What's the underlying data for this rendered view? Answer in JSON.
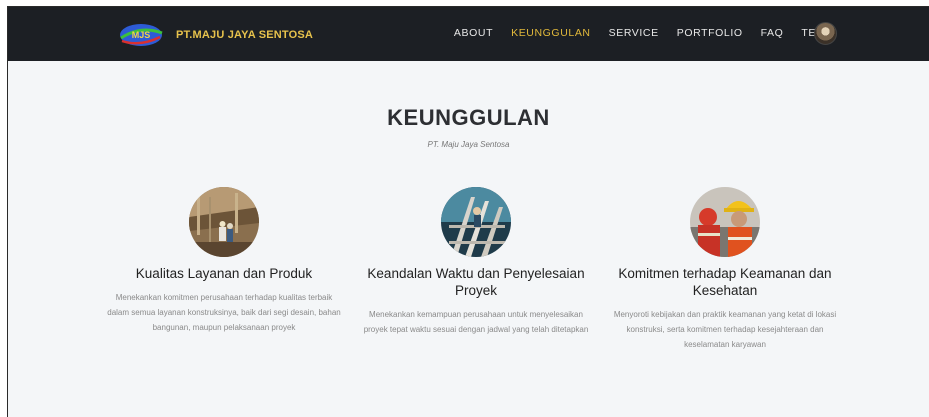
{
  "brand": {
    "name": "PT.MAJU JAYA SENTOSA",
    "logo_text": "MJS"
  },
  "nav": {
    "items": [
      {
        "label": "ABOUT",
        "active": false
      },
      {
        "label": "KEUNGGULAN",
        "active": true
      },
      {
        "label": "SERVICE",
        "active": false
      },
      {
        "label": "PORTFOLIO",
        "active": false
      },
      {
        "label": "FAQ",
        "active": false
      },
      {
        "label": "TEAM",
        "active": false
      }
    ]
  },
  "section": {
    "title": "KEUNGGULAN",
    "subtitle": "PT. Maju Jaya Sentosa"
  },
  "cards": [
    {
      "title": "Kualitas Layanan dan Produk",
      "description": "Menekankan komitmen perusahaan terhadap kualitas terbaik dalam semua layanan konstruksinya, baik dari segi desain, bahan bangunan, maupun pelaksanaan proyek"
    },
    {
      "title": "Keandalan Waktu dan Penyelesaian Proyek",
      "description": "Menekankan kemampuan perusahaan untuk menyelesaikan proyek tepat waktu sesuai dengan jadwal yang telah ditetapkan"
    },
    {
      "title": "Komitmen terhadap Keamanan dan Kesehatan",
      "description": "Menyoroti kebijakan dan praktik keamanan yang ketat di lokasi konstruksi, serta komitmen terhadap kesejahteraan dan keselamatan karyawan"
    }
  ],
  "colors": {
    "navbar_bg": "#1c1f24",
    "accent": "#e2b93b",
    "page_bg": "#f4f6f8"
  }
}
